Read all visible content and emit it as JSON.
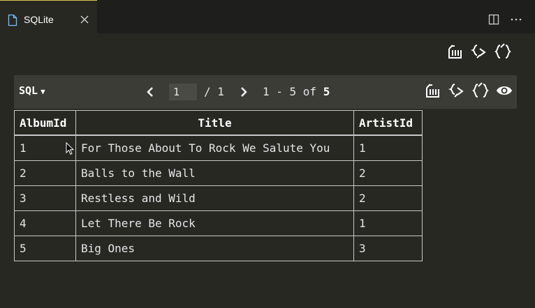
{
  "tab": {
    "title": "SQLite",
    "icons": [
      "file-icon",
      "close-icon"
    ]
  },
  "editor_actions": [
    "split-editor-icon",
    "more-actions-icon"
  ],
  "top_actions": [
    "export-csv-icon",
    "export-json-icon",
    "open-json-icon"
  ],
  "toolbar": {
    "sql_label": "SQL",
    "current_page": "1",
    "page_total": "/ 1",
    "range_text": "1 - 5 of",
    "total_rows": "5",
    "actions": [
      "export-csv-icon",
      "export-json-icon",
      "open-json-icon",
      "eye-icon"
    ]
  },
  "table": {
    "columns": [
      "AlbumId",
      "Title",
      "ArtistId"
    ],
    "rows": [
      [
        "1",
        "For Those About To Rock We Salute You",
        "1"
      ],
      [
        "2",
        "Balls to the Wall",
        "2"
      ],
      [
        "3",
        "Restless and Wild",
        "2"
      ],
      [
        "4",
        "Let There Be Rock",
        "1"
      ],
      [
        "5",
        "Big Ones",
        "3"
      ]
    ]
  }
}
